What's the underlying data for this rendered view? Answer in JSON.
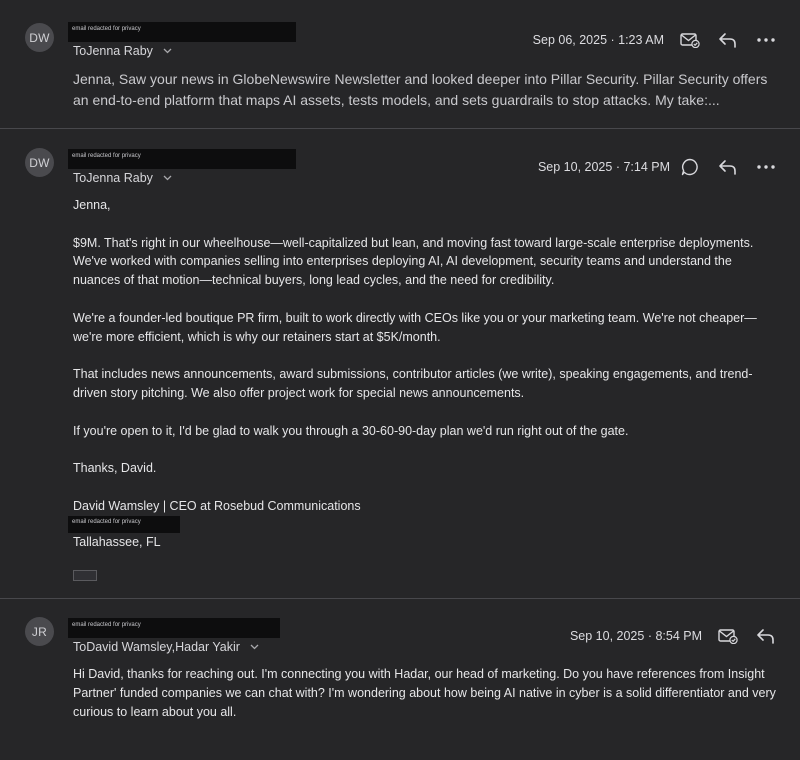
{
  "messages": [
    {
      "avatar_initials": "DW",
      "email_redacted": "email redacted for privacy",
      "to_label": "To",
      "to_names": "Jenna Raby",
      "date": "Sep 06, 2025 · 1:23 AM",
      "preview": "Jenna, Saw your news in GlobeNewswire Newsletter and looked deeper into Pillar Security. Pillar Security offers an end-to-end platform that maps AI assets, tests models, and sets guardrails to stop attacks. My take:..."
    },
    {
      "avatar_initials": "DW",
      "email_redacted": "email redacted for privacy",
      "to_label": "To",
      "to_names": "Jenna Raby",
      "date": "Sep 10, 2025 · 7:14 PM",
      "body": [
        "Jenna,",
        "$9M. That's right in our wheelhouse—well-capitalized but lean, and moving fast toward large-scale enterprise deployments. We've worked with companies selling into enterprises deploying AI, AI development, security teams and understand the nuances of that motion—technical buyers, long lead cycles, and the need for credibility.",
        "We're a founder-led boutique PR firm, built to work directly with CEOs like you or your marketing team. We're not cheaper—we're more efficient, which is why our retainers start at $5K/month.",
        "That includes news announcements, award submissions, contributor articles (we write), speaking engagements, and trend-driven story pitching. We also offer project work for special news announcements.",
        "If you're open to it, I'd be glad to walk you through a 30-60-90-day plan we'd run right out of the gate.",
        "Thanks, David."
      ],
      "signature_name": "David Wamsley | CEO at Rosebud Communications",
      "signature_email_redacted": "email redacted for privacy",
      "signature_location": "Tallahassee, FL"
    },
    {
      "avatar_initials": "JR",
      "email_redacted": "email redacted for privacy",
      "to_label": "To",
      "to_names": "David Wamsley,Hadar Yakir",
      "date": "Sep 10, 2025 · 8:54 PM",
      "body": [
        "Hi David, thanks for reaching out. I'm connecting you with Hadar, our head of marketing. Do you have references from Insight Partner' funded companies we can chat with? I'm wondering about how being AI native in cyber is a solid differentiator and very curious to learn about you all."
      ]
    }
  ],
  "icons": {
    "read_receipt": "mail-check-icon",
    "reply": "reply-icon",
    "more": "more-icon",
    "comment": "comment-icon",
    "chevron": "chevron-down-icon"
  },
  "colors": {
    "background": "#262628",
    "divider": "#48484c",
    "avatar": "#4a4a4e",
    "redaction": "#0d0d0e"
  }
}
